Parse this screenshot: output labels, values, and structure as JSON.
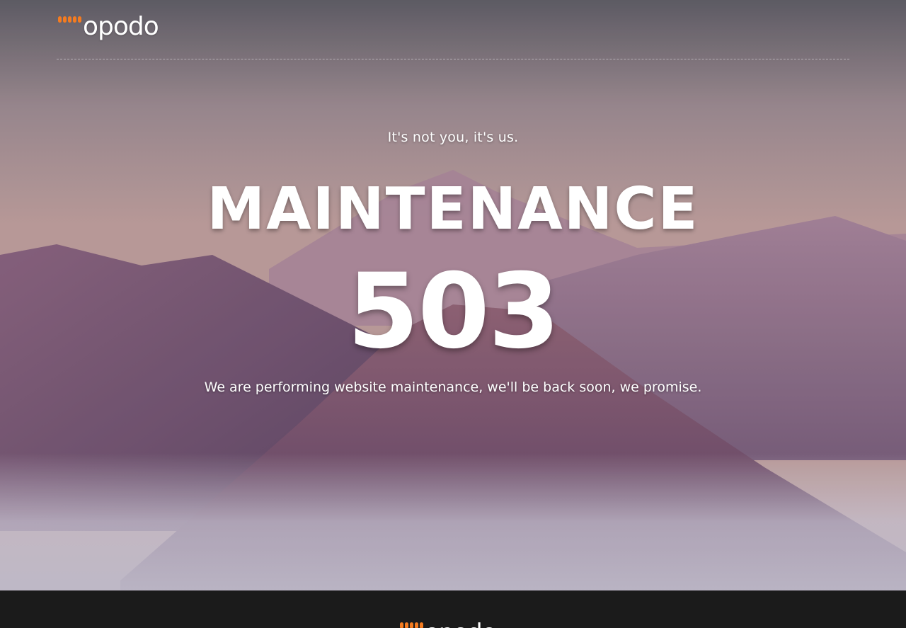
{
  "header": {
    "logo": {
      "text": "opodo",
      "dots_color": "#f47b20"
    }
  },
  "main": {
    "tagline": "It's not you, it's us.",
    "title": "MAINTENANCE",
    "code": "503",
    "message": "We are performing website maintenance, we'll be back soon, we promise."
  },
  "footer": {
    "logo": {
      "text": "opodo"
    }
  },
  "colors": {
    "brand_orange": "#f47b20",
    "footer_bg": "#1b1b1b",
    "text": "#ffffff"
  }
}
